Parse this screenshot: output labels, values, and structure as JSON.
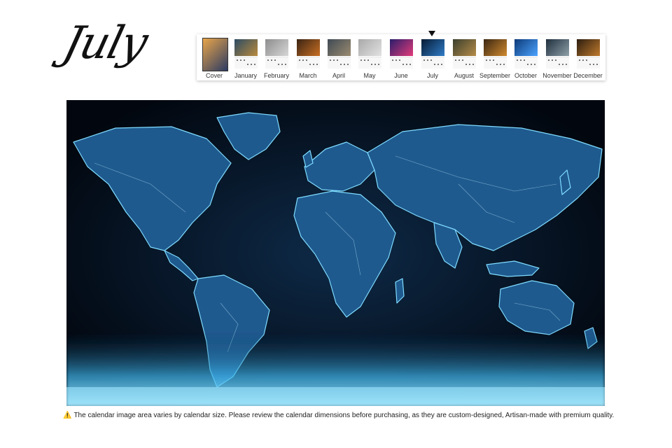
{
  "page": {
    "month_title": "July",
    "selected_month": "July"
  },
  "thumbnails": [
    {
      "label": "Cover",
      "top": "#e9a54a",
      "bottom": "#2b3a63",
      "kind": "cover"
    },
    {
      "label": "January",
      "top": "#2c4b63",
      "bottom": "#b98a3d"
    },
    {
      "label": "February",
      "top": "#8d8d8d",
      "bottom": "#d7d7d7"
    },
    {
      "label": "March",
      "top": "#3a2414",
      "bottom": "#c96f23"
    },
    {
      "label": "April",
      "top": "#3f4a54",
      "bottom": "#9b8b70"
    },
    {
      "label": "May",
      "top": "#a9a9a9",
      "bottom": "#e2e2e2"
    },
    {
      "label": "June",
      "top": "#2a1d6a",
      "bottom": "#e23b7a"
    },
    {
      "label": "July",
      "top": "#061a33",
      "bottom": "#2f7cc7"
    },
    {
      "label": "August",
      "top": "#3b3f2e",
      "bottom": "#b58c48"
    },
    {
      "label": "September",
      "top": "#3a2612",
      "bottom": "#d08a2e"
    },
    {
      "label": "October",
      "top": "#0d3a78",
      "bottom": "#4aa3ff"
    },
    {
      "label": "November",
      "top": "#1f2f3e",
      "bottom": "#8fa0a8"
    },
    {
      "label": "December",
      "top": "#2b1d10",
      "bottom": "#c07a2c"
    }
  ],
  "colors": {
    "map_ocean": "#02070f",
    "map_land": "#1f5a8f",
    "map_glow": "#6fd6ff",
    "strip_bg": "#ffffff"
  },
  "notice": {
    "icon": "warning-icon",
    "icon_glyph": "⚠️",
    "text": "The calendar image area varies by calendar size. Please review the calendar dimensions before purchasing, as they are custom-designed, Artisan-made with premium quality."
  }
}
